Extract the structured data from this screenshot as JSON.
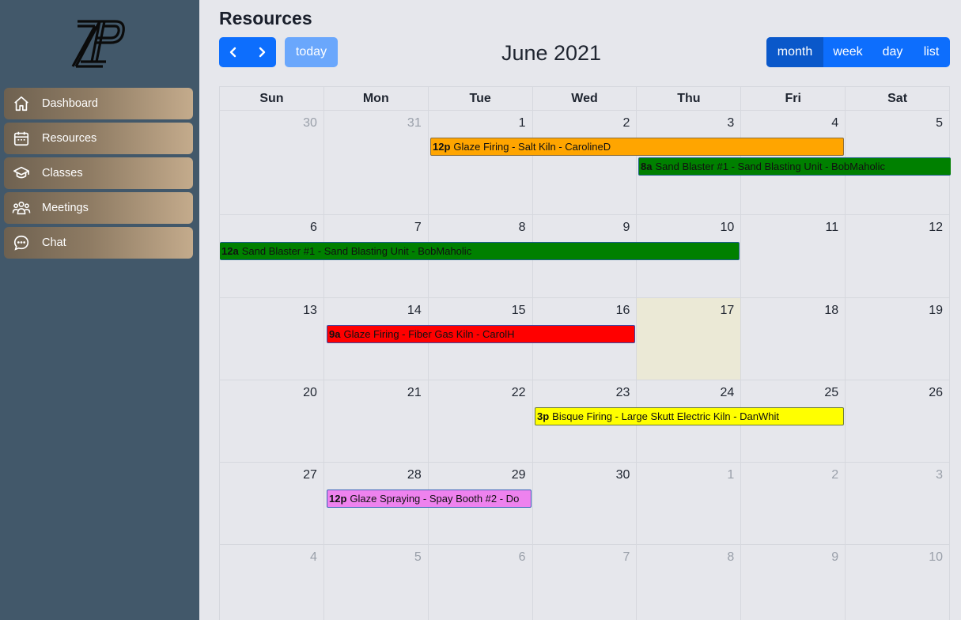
{
  "sidebar": {
    "items": [
      {
        "label": "Dashboard",
        "icon": "home-icon"
      },
      {
        "label": "Resources",
        "icon": "calendar-icon"
      },
      {
        "label": "Classes",
        "icon": "graduation-cap-icon"
      },
      {
        "label": "Meetings",
        "icon": "people-icon"
      },
      {
        "label": "Chat",
        "icon": "chat-bubble-icon"
      }
    ]
  },
  "header": {
    "title": "Resources",
    "today_label": "today",
    "calendar_title": "June 2021",
    "views": [
      "month",
      "week",
      "day",
      "list"
    ],
    "active_view": "month"
  },
  "calendar": {
    "weekdays": [
      "Sun",
      "Mon",
      "Tue",
      "Wed",
      "Thu",
      "Fri",
      "Sat"
    ],
    "weeks": [
      [
        "30",
        "31",
        "1",
        "2",
        "3",
        "4",
        "5"
      ],
      [
        "6",
        "7",
        "8",
        "9",
        "10",
        "11",
        "12"
      ],
      [
        "13",
        "14",
        "15",
        "16",
        "17",
        "18",
        "19"
      ],
      [
        "20",
        "21",
        "22",
        "23",
        "24",
        "25",
        "26"
      ],
      [
        "27",
        "28",
        "29",
        "30",
        "1",
        "2",
        "3"
      ],
      [
        "4",
        "5",
        "6",
        "7",
        "8",
        "9",
        "10"
      ]
    ],
    "today": "17",
    "events": [
      {
        "time": "12p",
        "title": "Glaze Firing - Salt Kiln - CarolineD",
        "color": "#ffa500"
      },
      {
        "time": "8a",
        "title": "Sand Blaster #1 - Sand Blasting Unit - BobMaholic",
        "color": "#008000"
      },
      {
        "time": "12a",
        "title": "Sand Blaster #1 - Sand Blasting Unit - BobMaholic",
        "color": "#008000"
      },
      {
        "time": "9a",
        "title": "Glaze Firing - Fiber Gas Kiln - CarolH",
        "color": "#ff0000"
      },
      {
        "time": "3p",
        "title": "Bisque Firing - Large Skutt Electric Kiln - DanWhit",
        "color": "#ffff00"
      },
      {
        "time": "12p",
        "title": "Glaze Spraying - Spay Booth #2 - Do",
        "color": "#ee82ee"
      }
    ]
  }
}
